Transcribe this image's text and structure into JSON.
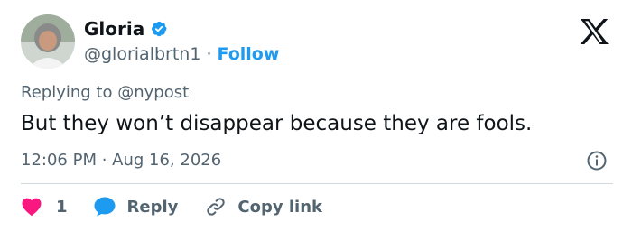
{
  "author": {
    "name": "Gloria",
    "handle": "@glorialbrtn1",
    "separator": "·",
    "follow_label": "Follow"
  },
  "icons": {
    "logo": "x-logo-icon",
    "verified": "verified-badge-icon",
    "info": "info-icon",
    "like": "heart-icon",
    "reply": "speech-bubble-icon",
    "copy": "link-icon"
  },
  "reply_context": {
    "prefix": "Replying to",
    "target": "@nypost"
  },
  "tweet": {
    "text": "But they won’t disappear because they are fools.",
    "timestamp": "12:06 PM · Aug 16, 2026"
  },
  "actions": {
    "like_count": "1",
    "reply_label": "Reply",
    "copy_label": "Copy link"
  },
  "colors": {
    "accent": "#1d9bf0",
    "like": "#f91880",
    "text": "#0f1419",
    "muted": "#536471",
    "divider": "#cfd9de"
  }
}
